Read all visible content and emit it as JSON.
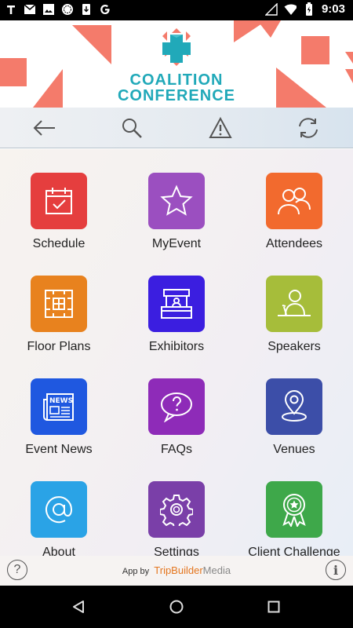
{
  "status_bar": {
    "left_icons": [
      "t-icon",
      "gmail-icon",
      "media-icon",
      "download-icon",
      "g-icon"
    ],
    "time": "9:03"
  },
  "banner": {
    "logo_line1": "COALITION",
    "logo_line2": "CONFERENCE",
    "accent_color": "#f47b6b",
    "logo_color": "#21a9b9"
  },
  "toolbar": {
    "buttons": [
      "back-arrow-icon",
      "search-icon",
      "alert-icon",
      "sync-icon"
    ]
  },
  "tiles": [
    {
      "label": "Schedule",
      "color": "#e53e3e",
      "icon": "calendar-check-icon"
    },
    {
      "label": "MyEvent",
      "color": "#9b4fc0",
      "icon": "star-icon"
    },
    {
      "label": "Attendees",
      "color": "#f26a2e",
      "icon": "people-icon"
    },
    {
      "label": "Floor Plans",
      "color": "#e8821e",
      "icon": "floor-plan-icon"
    },
    {
      "label": "Exhibitors",
      "color": "#3b1ee0",
      "icon": "booth-icon"
    },
    {
      "label": "Speakers",
      "color": "#a6bd3a",
      "icon": "speaker-icon"
    },
    {
      "label": "Event News",
      "color": "#1f58e0",
      "icon": "newspaper-icon"
    },
    {
      "label": "FAQs",
      "color": "#8e2bb8",
      "icon": "question-bubble-icon"
    },
    {
      "label": "Venues",
      "color": "#3c4ea8",
      "icon": "location-pin-icon"
    },
    {
      "label": "About",
      "color": "#2aa3e6",
      "icon": "at-sign-icon"
    },
    {
      "label": "Settings",
      "color": "#7a3fa8",
      "icon": "gear-icon"
    },
    {
      "label": "Client Challenge",
      "color": "#3ea84a",
      "icon": "award-ribbon-icon"
    }
  ],
  "footer": {
    "help": "?",
    "credit_prefix": "App by",
    "brand_part1": "TripBuilder",
    "brand_part2": "Media",
    "info": "i"
  }
}
